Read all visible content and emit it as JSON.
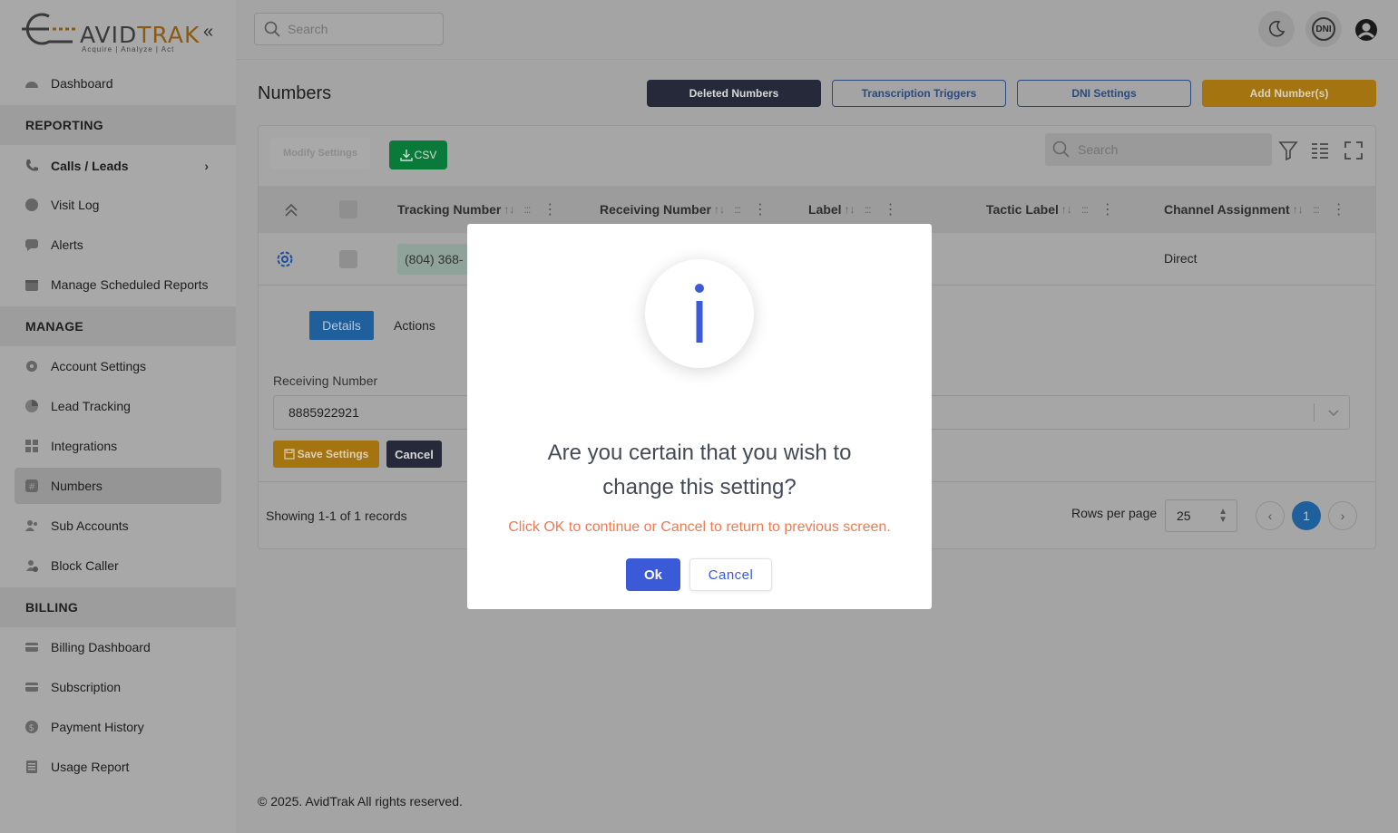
{
  "brand": {
    "name_prefix": "AVID",
    "name_suffix": "TRAK",
    "tagline": "Acquire | Analyze | Act"
  },
  "sidebar": {
    "items": [
      {
        "label": "Dashboard",
        "icon": "dashboard-icon"
      },
      {
        "section": "REPORTING"
      },
      {
        "label": "Calls / Leads",
        "icon": "phone-icon",
        "bold": true
      },
      {
        "label": "Visit Log",
        "icon": "globe-icon"
      },
      {
        "label": "Alerts",
        "icon": "chat-icon"
      },
      {
        "label": "Manage Scheduled Reports",
        "icon": "calendar-icon"
      },
      {
        "section": "MANAGE"
      },
      {
        "label": "Account Settings",
        "icon": "gear-icon"
      },
      {
        "label": "Lead Tracking",
        "icon": "pie-chart-icon"
      },
      {
        "label": "Integrations",
        "icon": "grid-icon"
      },
      {
        "label": "Numbers",
        "icon": "hash-icon",
        "active": true
      },
      {
        "label": "Sub Accounts",
        "icon": "users-icon"
      },
      {
        "label": "Block Caller",
        "icon": "user-block-icon"
      },
      {
        "section": "BILLING"
      },
      {
        "label": "Billing Dashboard",
        "icon": "card-icon"
      },
      {
        "label": "Subscription",
        "icon": "subscription-icon"
      },
      {
        "label": "Payment History",
        "icon": "dollar-icon"
      },
      {
        "label": "Usage Report",
        "icon": "report-icon"
      }
    ]
  },
  "header": {
    "search_placeholder": "Search",
    "dni_badge": "DNI"
  },
  "page": {
    "title": "Numbers",
    "buttons": {
      "deleted": "Deleted Numbers",
      "transcription": "Transcription Triggers",
      "dni_settings": "DNI Settings",
      "add": "Add Number(s)"
    }
  },
  "toolbar": {
    "modify": "Modify Settings",
    "csv": "CSV",
    "search_placeholder": "Search"
  },
  "table": {
    "columns": [
      "Tracking Number",
      "Receiving Number",
      "Label",
      "Tactic Label",
      "Channel Assignment"
    ],
    "row": {
      "tracking": "(804) 368-",
      "channel": "Direct"
    }
  },
  "detail": {
    "tabs": {
      "details": "Details",
      "actions": "Actions"
    },
    "receiving_label": "Receiving Number",
    "receiving_value": "8885922921",
    "save": "Save Settings",
    "cancel": "Cancel"
  },
  "pagination": {
    "showing": "Showing 1-1 of 1 records",
    "rows_label": "Rows per page",
    "rows_value": "25",
    "current_page": "1"
  },
  "modal": {
    "title_line1": "Are you certain that you wish to",
    "title_line2": "change this setting?",
    "text": "Click OK to continue or Cancel to return to previous screen.",
    "ok": "Ok",
    "cancel": "Cancel"
  },
  "footer": {
    "copyright": "© 2025. AvidTrak All rights reserved."
  },
  "colors": {
    "accent_blue": "#3a5ad8",
    "warning_orange": "#f07a52",
    "csv_green": "#0a7a3a"
  }
}
